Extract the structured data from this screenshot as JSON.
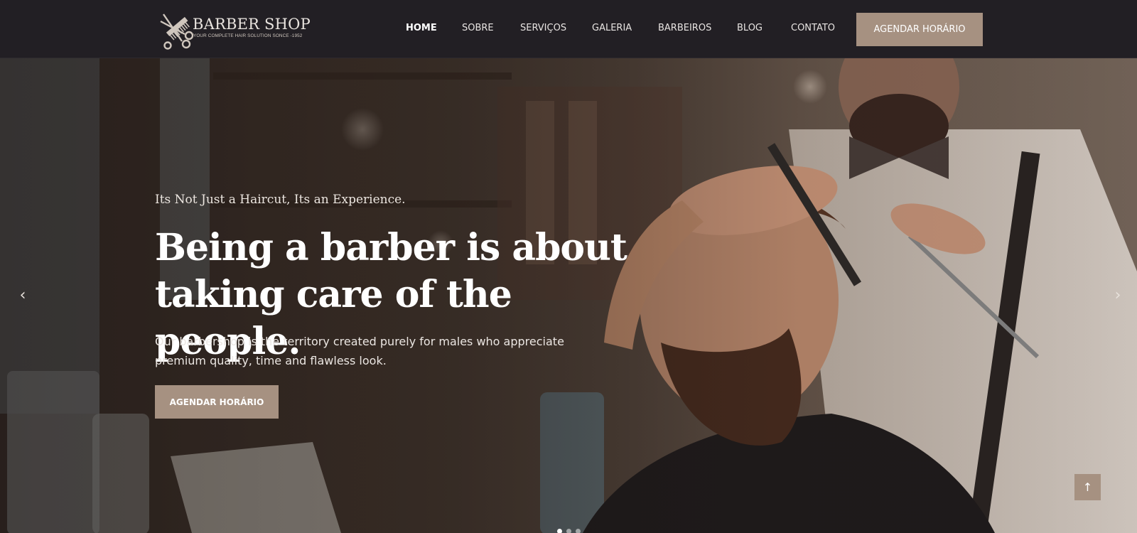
{
  "brand": {
    "title": "BARBER SHOP",
    "subtitle": "YOUR COMPLETE HAIR SOLUTION SONCE -1952",
    "logo_icon": "comb-scissors-icon"
  },
  "nav": {
    "items": [
      {
        "label": "HOME",
        "active": true
      },
      {
        "label": "SOBRE",
        "active": false
      },
      {
        "label": "SERVIÇOS",
        "active": false
      },
      {
        "label": "GALERIA",
        "active": false
      },
      {
        "label": "BARBEIROS",
        "active": false
      },
      {
        "label": "BLOG",
        "active": false
      },
      {
        "label": "CONTATO",
        "active": false
      }
    ],
    "cta_label": "AGENDAR HORÁRIO"
  },
  "hero": {
    "tagline": "Its Not Just a Haircut, Its an Experience.",
    "headline_line1": "Being a barber is about",
    "headline_line2": "taking care of the people.",
    "description_line1": "Our barbershop is the territory created purely for males who appreciate",
    "description_line2": "premium quality, time and flawless look.",
    "cta_label": "AGENDAR HORÁRIO",
    "prev_icon": "chevron-left-icon",
    "next_icon": "chevron-right-icon",
    "slide_count": 3,
    "active_slide": 1
  },
  "scroll_top_icon": "arrow-up-icon",
  "colors": {
    "header_bg": "#221f24",
    "accent": "#a69181",
    "text_light": "#ffffff"
  }
}
